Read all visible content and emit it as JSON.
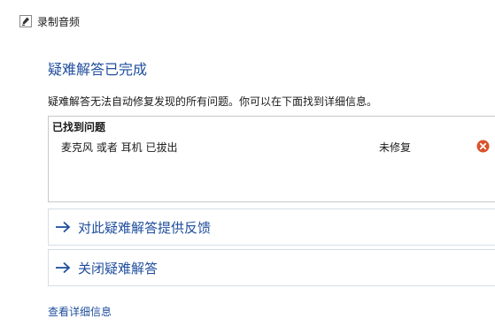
{
  "window": {
    "title": "录制音频",
    "icon": "microphone-icon"
  },
  "main": {
    "heading": "疑难解答已完成",
    "description": "疑难解答无法自动修复发现的所有问题。你可以在下面找到详细信息。",
    "problems": {
      "header": "已找到问题",
      "items": [
        {
          "name": "麦克风 或者 耳机 已拔出",
          "status": "未修复",
          "status_icon": "error-icon",
          "status_color": "#d9532c"
        }
      ]
    },
    "actions": [
      {
        "label": "对此疑难解答提供反馈",
        "icon": "arrow-right-icon"
      },
      {
        "label": "关闭疑难解答",
        "icon": "arrow-right-icon"
      }
    ],
    "details_link": "查看详细信息"
  },
  "colors": {
    "accent": "#1f4e9c",
    "error": "#d9532c",
    "border": "#c8c8c8"
  }
}
